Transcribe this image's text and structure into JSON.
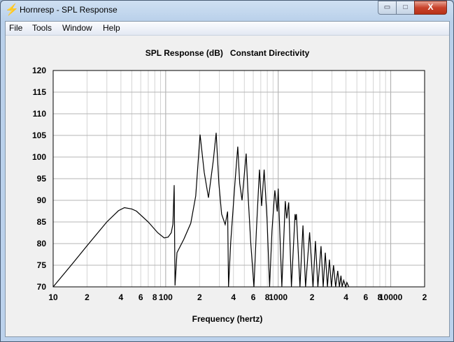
{
  "window": {
    "title": "Hornresp - SPL Response",
    "minimize_label": "▭",
    "maximize_label": "□",
    "close_label": "X",
    "app_icon": "lightning-bolt-icon"
  },
  "menu": {
    "items": [
      {
        "label": "File"
      },
      {
        "label": "Tools"
      },
      {
        "label": "Window"
      },
      {
        "label": "Help"
      }
    ]
  },
  "chart_data": {
    "type": "line",
    "title": "SPL Response (dB)   Constant Directivity",
    "xlabel": "Frequency (hertz)",
    "ylabel": "",
    "xscale": "log",
    "xlim": [
      10,
      20000
    ],
    "ylim": [
      70,
      120
    ],
    "grid": true,
    "yticks": [
      70,
      75,
      80,
      85,
      90,
      95,
      100,
      105,
      110,
      115,
      120
    ],
    "xticks": [
      {
        "value": 10,
        "label": "10"
      },
      {
        "value": 20,
        "label": "2"
      },
      {
        "value": 40,
        "label": "4"
      },
      {
        "value": 60,
        "label": "6"
      },
      {
        "value": 80,
        "label": "8"
      },
      {
        "value": 100,
        "label": "100"
      },
      {
        "value": 200,
        "label": "2"
      },
      {
        "value": 400,
        "label": "4"
      },
      {
        "value": 600,
        "label": "6"
      },
      {
        "value": 800,
        "label": "8"
      },
      {
        "value": 1000,
        "label": "1000"
      },
      {
        "value": 2000,
        "label": "2"
      },
      {
        "value": 4000,
        "label": "4"
      },
      {
        "value": 6000,
        "label": "6"
      },
      {
        "value": 8000,
        "label": "8"
      },
      {
        "value": 10000,
        "label": "10000"
      },
      {
        "value": 20000,
        "label": "2"
      }
    ],
    "series": [
      {
        "name": "SPL",
        "color": "#000000",
        "points": [
          [
            10,
            70
          ],
          [
            15,
            75.5
          ],
          [
            20,
            79.5
          ],
          [
            30,
            85
          ],
          [
            38,
            87.6
          ],
          [
            43,
            88.3
          ],
          [
            50,
            88
          ],
          [
            55,
            87.5
          ],
          [
            70,
            85
          ],
          [
            85,
            82.5
          ],
          [
            97,
            81.3
          ],
          [
            105,
            81.5
          ],
          [
            112,
            82.5
          ],
          [
            116,
            84.5
          ],
          [
            119,
            93.5
          ],
          [
            121,
            70.3
          ],
          [
            126,
            77.9
          ],
          [
            145,
            81
          ],
          [
            167,
            84.7
          ],
          [
            185,
            91
          ],
          [
            202,
            105.2
          ],
          [
            220,
            96.5
          ],
          [
            240,
            90.6
          ],
          [
            265,
            99.2
          ],
          [
            281,
            105.6
          ],
          [
            297,
            93.9
          ],
          [
            314,
            86.8
          ],
          [
            338,
            84.4
          ],
          [
            355,
            87.4
          ],
          [
            362,
            70
          ],
          [
            378,
            80.3
          ],
          [
            412,
            93.9
          ],
          [
            437,
            102.4
          ],
          [
            455,
            93.9
          ],
          [
            477,
            90
          ],
          [
            519,
            100.8
          ],
          [
            540,
            91
          ],
          [
            570,
            80.3
          ],
          [
            608,
            70
          ],
          [
            640,
            83
          ],
          [
            681,
            97.1
          ],
          [
            712,
            88.7
          ],
          [
            750,
            97.1
          ],
          [
            795,
            85.8
          ],
          [
            838,
            70
          ],
          [
            880,
            83
          ],
          [
            933,
            92.3
          ],
          [
            980,
            87.4
          ],
          [
            1000,
            92.7
          ],
          [
            1077,
            70
          ],
          [
            1156,
            89.8
          ],
          [
            1190,
            85.8
          ],
          [
            1240,
            89.5
          ],
          [
            1310,
            70
          ],
          [
            1411,
            86.8
          ],
          [
            1430,
            85.5
          ],
          [
            1450,
            86.8
          ],
          [
            1560,
            70
          ],
          [
            1660,
            84.2
          ],
          [
            1750,
            70
          ],
          [
            1900,
            82.6
          ],
          [
            2040,
            70
          ],
          [
            2140,
            80.6
          ],
          [
            2250,
            70
          ],
          [
            2400,
            79.4
          ],
          [
            2510,
            70
          ],
          [
            2620,
            77.9
          ],
          [
            2740,
            70
          ],
          [
            2850,
            76.3
          ],
          [
            2970,
            70
          ],
          [
            3100,
            75
          ],
          [
            3240,
            70
          ],
          [
            3380,
            73.7
          ],
          [
            3500,
            70
          ],
          [
            3610,
            72.6
          ],
          [
            3700,
            70
          ],
          [
            3820,
            71.5
          ],
          [
            3980,
            70
          ],
          [
            4080,
            71
          ],
          [
            4240,
            70
          ]
        ]
      }
    ]
  }
}
